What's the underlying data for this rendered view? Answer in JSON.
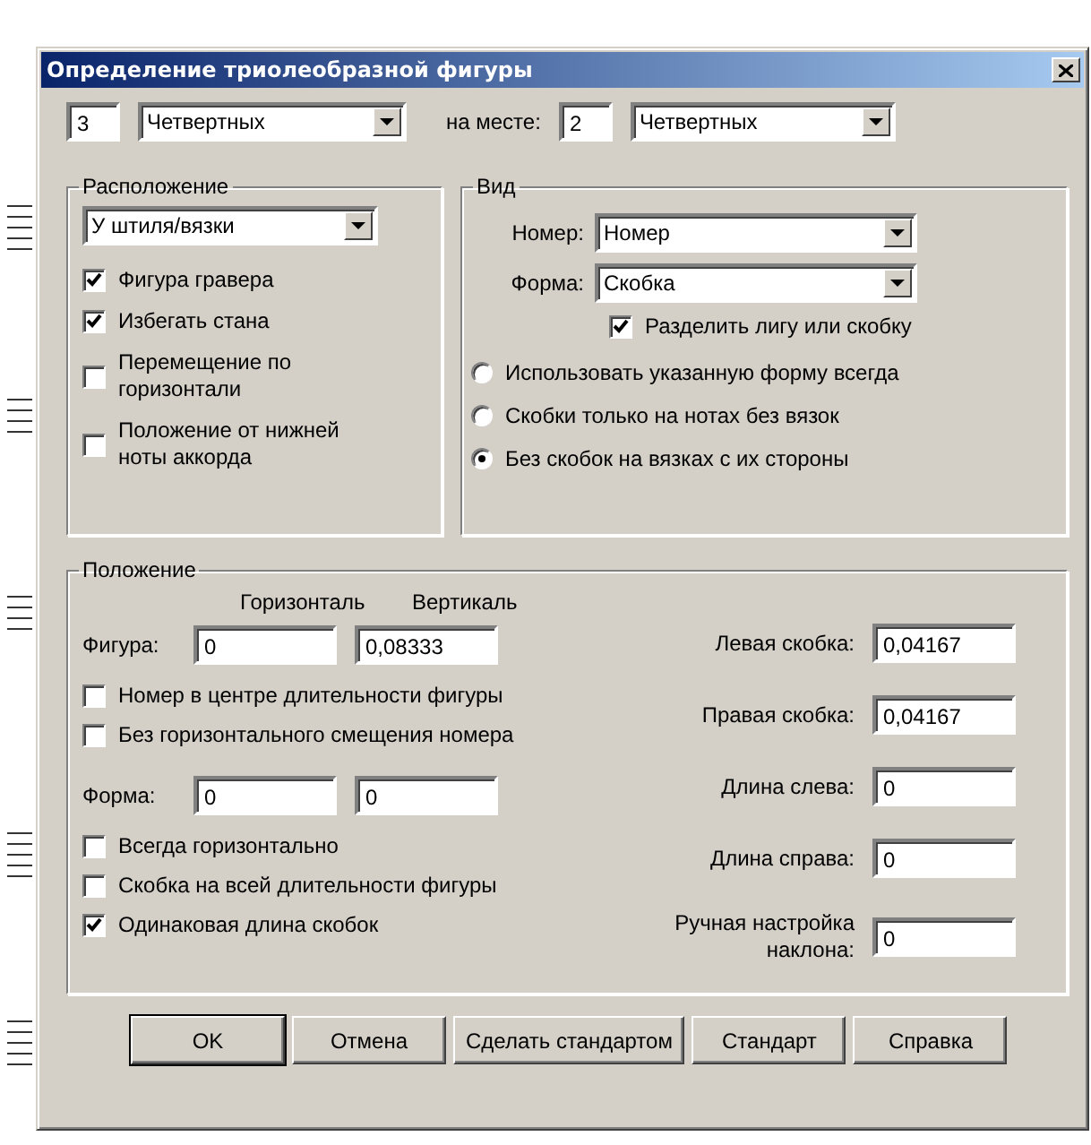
{
  "window": {
    "title": "Определение триолеобразной фигуры"
  },
  "top": {
    "count": "3",
    "count_unit": "Четвертных",
    "in_place_label": "на месте:",
    "in_place": "2",
    "in_place_unit": "Четвертных"
  },
  "placement": {
    "title": "Расположение",
    "position": "У штиля/вязки",
    "options": [
      {
        "label": "Фигура гравера",
        "checked": true
      },
      {
        "label": "Избегать стана",
        "checked": true
      },
      {
        "label": "Перемещение по горизонтали",
        "checked": false
      },
      {
        "label": "Положение от нижней ноты аккорда",
        "checked": false
      }
    ]
  },
  "view": {
    "title": "Вид",
    "number_label": "Номер:",
    "number": "Номер",
    "shape_label": "Форма:",
    "shape": "Скобка",
    "split": {
      "label": "Разделить лигу или скобку",
      "checked": true
    },
    "modes": [
      {
        "label": "Использовать указанную форму всегда",
        "selected": false
      },
      {
        "label": "Скобки только на нотах без вязок",
        "selected": false
      },
      {
        "label": "Без скобок на вязках с их стороны",
        "selected": true
      }
    ]
  },
  "position": {
    "title": "Положение",
    "col_labels": [
      "Горизонталь",
      "Вертикаль"
    ],
    "figure_label": "Фигура:",
    "figure": [
      "0",
      "0,08333"
    ],
    "options_a": [
      {
        "label": "Номер в центре длительности фигуры",
        "checked": false
      },
      {
        "label": "Без горизонтального смещения номера",
        "checked": false
      }
    ],
    "shape_label": "Форма:",
    "shape": [
      "0",
      "0"
    ],
    "options_b": [
      {
        "label": "Всегда горизонтально",
        "checked": false
      },
      {
        "label": "Скобка на всей длительности фигуры",
        "checked": false
      },
      {
        "label": "Одинаковая длина скобок",
        "checked": true
      }
    ],
    "right_fields": [
      {
        "label": "Левая скобка:",
        "value": "0,04167"
      },
      {
        "label": "Правая скобка:",
        "value": "0,04167"
      },
      {
        "label": "Длина слева:",
        "value": "0"
      },
      {
        "label": "Длина справа:",
        "value": "0"
      },
      {
        "label": "Ручная настройка наклона:",
        "value": "0"
      }
    ]
  },
  "buttons": [
    {
      "label": "OK",
      "default": true
    },
    {
      "label": "Отмена",
      "default": false
    },
    {
      "label": "Сделать стандартом",
      "default": false
    },
    {
      "label": "Стандарт",
      "default": false
    },
    {
      "label": "Справка",
      "default": false
    }
  ]
}
